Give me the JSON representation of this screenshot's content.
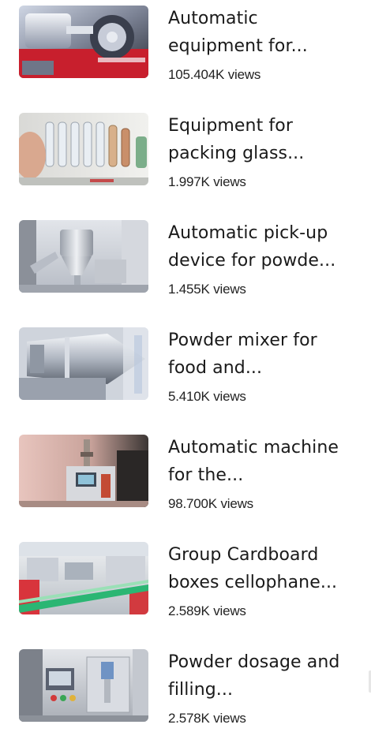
{
  "videos": [
    {
      "title": "Automatic equipment for the production of powder",
      "title_display": "Automatic equipment for...",
      "views": "105.404K views",
      "thumbnail": "automatic-equipment-thumbnail"
    },
    {
      "title": "Equipment for packing glass ampoules",
      "title_display": "Equipment for packing glass...",
      "views": "1.997K views",
      "thumbnail": "glass-ampoules-thumbnail"
    },
    {
      "title": "Automatic pick-up device for powder",
      "title_display": "Automatic pick-up device for powde...",
      "views": "1.455K views",
      "thumbnail": "pick-up-device-thumbnail"
    },
    {
      "title": "Powder mixer for food and pharmaceuticals",
      "title_display": "Powder mixer for food and...",
      "views": "5.410K views",
      "thumbnail": "powder-mixer-thumbnail"
    },
    {
      "title": "Automatic machine for the filling",
      "title_display": "Automatic machine for the...",
      "views": "98.700K views",
      "thumbnail": "automatic-machine-thumbnail"
    },
    {
      "title": "Group Cardboard boxes cellophane wrapping",
      "title_display": "Group Cardboard boxes cellophane...",
      "views": "2.589K views",
      "thumbnail": "cardboard-boxes-thumbnail"
    },
    {
      "title": "Powder dosage and filling machine",
      "title_display": "Powder dosage and filling...",
      "views": "2.578K views",
      "thumbnail": "powder-dosage-thumbnail"
    }
  ]
}
